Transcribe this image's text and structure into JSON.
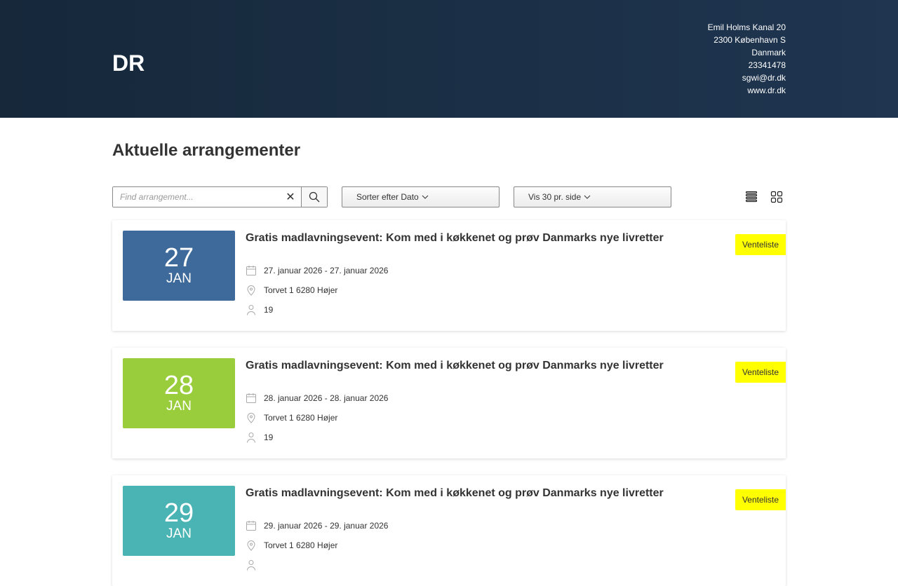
{
  "header": {
    "logo": "DR",
    "contact": [
      "Emil Holms Kanal 20",
      "2300 København S",
      "Danmark",
      "23341478",
      "sgwi@dr.dk",
      "www.dr.dk"
    ]
  },
  "page_title": "Aktuelle arrangementer",
  "toolbar": {
    "search_placeholder": "Find arrangement...",
    "search_value": "",
    "sort_label": "Sorter efter Dato",
    "per_page_label": "Vis 30 pr. side"
  },
  "events": [
    {
      "day": "27",
      "month": "JAN",
      "color": "#3d6a9a",
      "title": "Gratis madlavningsevent: Kom med i køkkenet og prøv Danmarks nye livretter",
      "dates": "27. januar 2026 - 27. januar 2026",
      "location": "Torvet 1 6280 Højer",
      "participants": "19",
      "badge": "Venteliste"
    },
    {
      "day": "28",
      "month": "JAN",
      "color": "#9acd3c",
      "title": "Gratis madlavningsevent: Kom med i køkkenet og prøv Danmarks nye livretter",
      "dates": "28. januar 2026 - 28. januar 2026",
      "location": "Torvet 1 6280 Højer",
      "participants": "19",
      "badge": "Venteliste"
    },
    {
      "day": "29",
      "month": "JAN",
      "color": "#4ab3b3",
      "title": "Gratis madlavningsevent: Kom med i køkkenet og prøv Danmarks nye livretter",
      "dates": "29. januar 2026 - 29. januar 2026",
      "location": "Torvet 1 6280 Højer",
      "badge": "Venteliste"
    }
  ]
}
